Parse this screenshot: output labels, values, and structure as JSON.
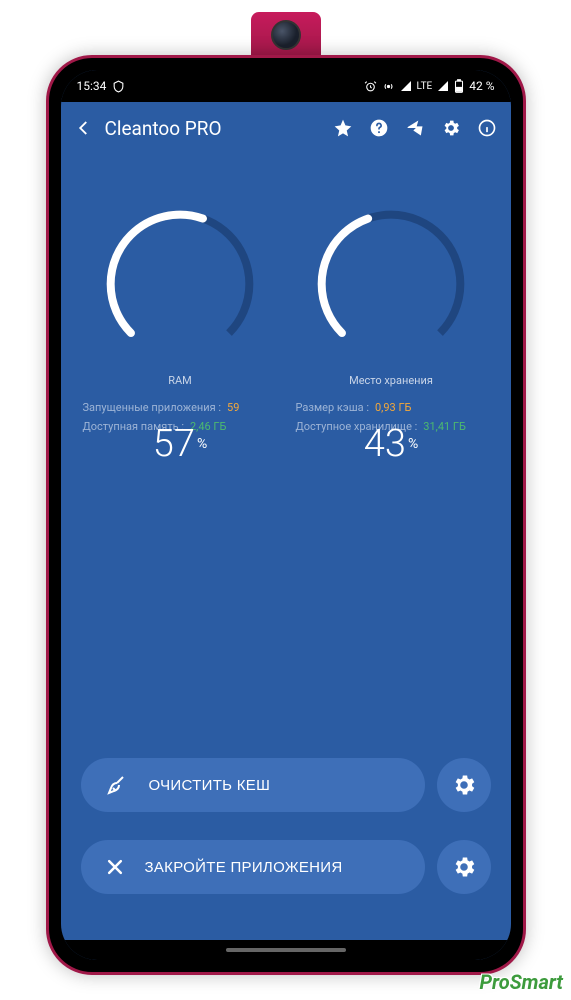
{
  "status": {
    "time": "15:34",
    "network": "LTE",
    "battery": "42 %"
  },
  "appbar": {
    "title": "Cleantoo PRO"
  },
  "gauges": {
    "ram": {
      "value": "57",
      "pct_sign": "%",
      "label": "RAM"
    },
    "storage": {
      "value": "43",
      "pct_sign": "%",
      "label": "Место хранения"
    }
  },
  "stats": {
    "left": {
      "row1_label": "Запущенные приложения :",
      "row1_value": "59",
      "row2_label": "Доступная память :",
      "row2_value": "2,46 ГБ"
    },
    "right": {
      "row1_label": "Размер кэша :",
      "row1_value": "0,93 ГБ",
      "row2_label": "Доступное хранилище :",
      "row2_value": "31,41 ГБ"
    }
  },
  "actions": {
    "clear_cache": "ОЧИСТИТЬ КЕШ",
    "close_apps": "ЗАКРОЙТЕ ПРИЛОЖЕНИЯ"
  },
  "watermark": "ProSmart"
}
